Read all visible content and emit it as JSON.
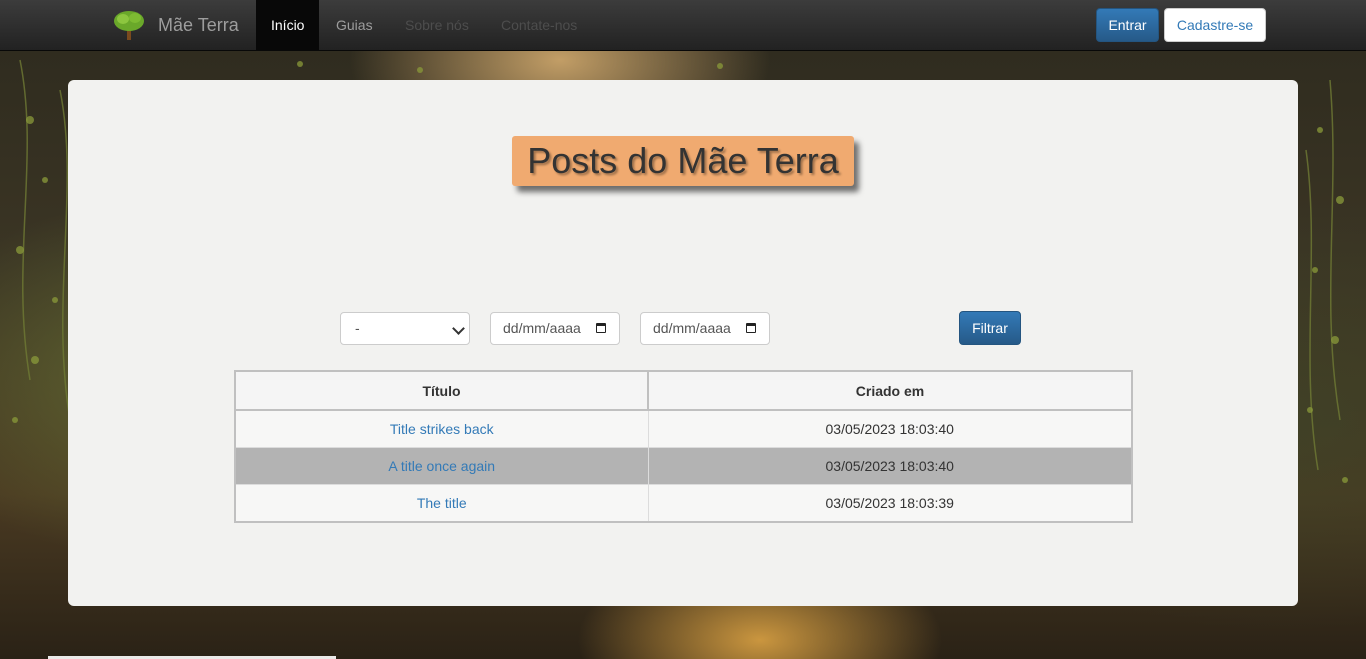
{
  "navbar": {
    "brand": "Mãe Terra",
    "links": [
      "Início",
      "Guias",
      "Sobre nós",
      "Contate-nos"
    ],
    "login_label": "Entrar",
    "signup_label": "Cadastre-se"
  },
  "main": {
    "heading": "Posts do Mãe Terra",
    "filters": {
      "category_selected": "-",
      "date_from_placeholder": "dd/mm/aaaa",
      "date_to_placeholder": "dd/mm/aaaa",
      "filter_button": "Filtrar"
    },
    "table": {
      "headers": [
        "Título",
        "Criado em"
      ],
      "rows": [
        {
          "title": "Title strikes back",
          "created": "03/05/2023 18:03:40"
        },
        {
          "title": "A title once again",
          "created": "03/05/2023 18:03:40"
        },
        {
          "title": "The title",
          "created": "03/05/2023 18:03:39"
        }
      ]
    }
  },
  "colors": {
    "primary": "#337ab7",
    "heading_bg": "#f0aa70",
    "navbar_bg": "#222222"
  }
}
